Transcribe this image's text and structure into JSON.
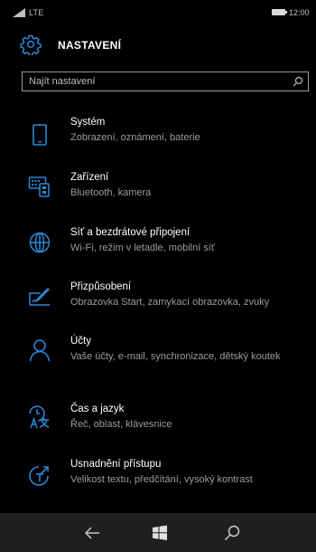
{
  "status_bar": {
    "network": "LTE",
    "time": "12:00"
  },
  "header": {
    "title": "NASTAVENÍ",
    "icon": "gear-icon"
  },
  "search": {
    "placeholder": "Najít nastavení",
    "icon": "search-icon"
  },
  "settings": {
    "items": [
      {
        "title": "Systém",
        "description": "Zobrazení, oznámení, baterie",
        "icon": "phone-icon"
      },
      {
        "title": "Zařízení",
        "description": "Bluetooth, kamera",
        "icon": "keyboard-icon"
      },
      {
        "title": "Síť a bezdrátové připojení",
        "description": "Wi-Fi, režim v letadle, mobilní síť",
        "icon": "globe-icon"
      },
      {
        "title": "Přizpůsobení",
        "description": "Obrazovka Start, zamykací obrazovka, zvuky",
        "icon": "paint-brush-icon"
      },
      {
        "title": "Účty",
        "description": "Vaše účty, e-mail, synchronizace, dětský koutek",
        "icon": "person-icon"
      },
      {
        "title": "Čas a jazyk",
        "description": "Řeč, oblast, klávesnice",
        "icon": "time-language-icon"
      },
      {
        "title": "Usnadnění přístupu",
        "description": "Velikost textu, předčítání, vysoký kontrast",
        "icon": "accessibility-icon"
      }
    ]
  },
  "nav_bar": {
    "back_icon": "back-arrow-icon",
    "start_icon": "windows-logo-icon",
    "search_icon": "search-icon"
  },
  "colors": {
    "accent": "#2b88d8",
    "background": "#000000",
    "secondary_text": "#9c9c9c",
    "nav_bar": "#1f1f1f"
  }
}
